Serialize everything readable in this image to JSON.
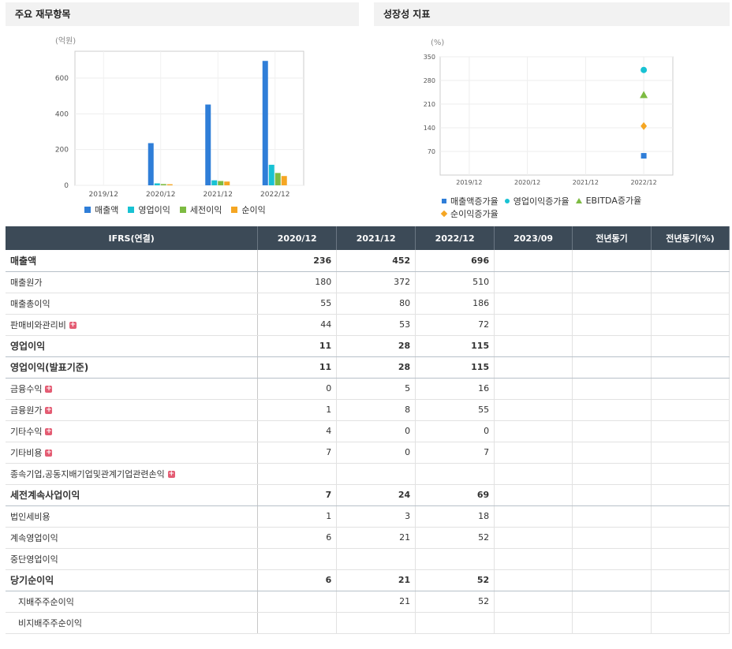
{
  "left_panel": {
    "title": "주요 재무항목"
  },
  "right_panel": {
    "title": "성장성 지표"
  },
  "colors": {
    "sales": "#2f7ed8",
    "op": "#18c2d3",
    "pretax": "#7dbb42",
    "net": "#f5a623"
  },
  "chart_data": [
    {
      "type": "bar",
      "title": "주요 재무항목",
      "unit_label": "(억원)",
      "categories": [
        "2019/12",
        "2020/12",
        "2021/12",
        "2022/12"
      ],
      "ylim": [
        0,
        750
      ],
      "yticks": [
        "0",
        "200",
        "400",
        "600"
      ],
      "ytick_values": [
        0,
        200,
        400,
        600
      ],
      "legend_position": "bottom",
      "series": [
        {
          "name": "매출액",
          "color": "#2f7ed8",
          "values": [
            null,
            236,
            452,
            696
          ]
        },
        {
          "name": "영업이익",
          "color": "#18c2d3",
          "values": [
            null,
            11,
            28,
            115
          ]
        },
        {
          "name": "세전이익",
          "color": "#7dbb42",
          "values": [
            null,
            7,
            24,
            69
          ]
        },
        {
          "name": "순이익",
          "color": "#f5a623",
          "values": [
            null,
            6,
            21,
            52
          ]
        }
      ]
    },
    {
      "type": "scatter",
      "title": "성장성 지표",
      "unit_label": "(%)",
      "categories": [
        "2019/12",
        "2020/12",
        "2021/12",
        "2022/12"
      ],
      "ylim": [
        0,
        350
      ],
      "yticks": [
        "70",
        "140",
        "210",
        "280",
        "350"
      ],
      "ytick_values": [
        70,
        140,
        210,
        280,
        350
      ],
      "legend_position": "bottom",
      "series": [
        {
          "name": "매출액증가율",
          "color": "#2f7ed8",
          "shape": "square",
          "values": [
            null,
            null,
            null,
            57
          ]
        },
        {
          "name": "영업이익증가율",
          "color": "#18c2d3",
          "shape": "circle",
          "values": [
            null,
            null,
            null,
            311
          ]
        },
        {
          "name": "EBITDA증가율",
          "color": "#7dbb42",
          "shape": "triangle",
          "values": [
            null,
            null,
            null,
            237
          ]
        },
        {
          "name": "순이익증가율",
          "color": "#f5a623",
          "shape": "diamond",
          "values": [
            null,
            null,
            null,
            145
          ]
        }
      ]
    }
  ],
  "table": {
    "headers": [
      "IFRS(연결)",
      "2020/12",
      "2021/12",
      "2022/12",
      "2023/09",
      "전년동기",
      "전년동기(%)"
    ],
    "rows": [
      {
        "label": "매출액",
        "bold": true,
        "plus": false,
        "sub": false,
        "values": [
          "236",
          "452",
          "696",
          "",
          "",
          ""
        ]
      },
      {
        "label": "매출원가",
        "bold": false,
        "plus": false,
        "sub": false,
        "values": [
          "180",
          "372",
          "510",
          "",
          "",
          ""
        ]
      },
      {
        "label": "매출총이익",
        "bold": false,
        "plus": false,
        "sub": false,
        "values": [
          "55",
          "80",
          "186",
          "",
          "",
          ""
        ]
      },
      {
        "label": "판매비와관리비",
        "bold": false,
        "plus": true,
        "sub": false,
        "values": [
          "44",
          "53",
          "72",
          "",
          "",
          ""
        ]
      },
      {
        "label": "영업이익",
        "bold": true,
        "plus": false,
        "sub": false,
        "values": [
          "11",
          "28",
          "115",
          "",
          "",
          ""
        ]
      },
      {
        "label": "영업이익(발표기준)",
        "bold": true,
        "plus": false,
        "sub": false,
        "values": [
          "11",
          "28",
          "115",
          "",
          "",
          ""
        ]
      },
      {
        "label": "금융수익",
        "bold": false,
        "plus": true,
        "sub": false,
        "values": [
          "0",
          "5",
          "16",
          "",
          "",
          ""
        ]
      },
      {
        "label": "금융원가",
        "bold": false,
        "plus": true,
        "sub": false,
        "values": [
          "1",
          "8",
          "55",
          "",
          "",
          ""
        ]
      },
      {
        "label": "기타수익",
        "bold": false,
        "plus": true,
        "sub": false,
        "values": [
          "4",
          "0",
          "0",
          "",
          "",
          ""
        ]
      },
      {
        "label": "기타비용",
        "bold": false,
        "plus": true,
        "sub": false,
        "values": [
          "7",
          "0",
          "7",
          "",
          "",
          ""
        ]
      },
      {
        "label": "종속기업,공동지배기업및관계기업관련손익",
        "bold": false,
        "plus": true,
        "sub": false,
        "values": [
          "",
          "",
          "",
          "",
          "",
          ""
        ]
      },
      {
        "label": "세전계속사업이익",
        "bold": true,
        "plus": false,
        "sub": false,
        "values": [
          "7",
          "24",
          "69",
          "",
          "",
          ""
        ]
      },
      {
        "label": "법인세비용",
        "bold": false,
        "plus": false,
        "sub": false,
        "values": [
          "1",
          "3",
          "18",
          "",
          "",
          ""
        ]
      },
      {
        "label": "계속영업이익",
        "bold": false,
        "plus": false,
        "sub": false,
        "values": [
          "6",
          "21",
          "52",
          "",
          "",
          ""
        ]
      },
      {
        "label": "중단영업이익",
        "bold": false,
        "plus": false,
        "sub": false,
        "values": [
          "",
          "",
          "",
          "",
          "",
          ""
        ]
      },
      {
        "label": "당기순이익",
        "bold": true,
        "plus": false,
        "sub": false,
        "values": [
          "6",
          "21",
          "52",
          "",
          "",
          ""
        ]
      },
      {
        "label": "지배주주순이익",
        "bold": false,
        "plus": false,
        "sub": true,
        "values": [
          "",
          "21",
          "52",
          "",
          "",
          ""
        ]
      },
      {
        "label": "비지배주주순이익",
        "bold": false,
        "plus": false,
        "sub": true,
        "values": [
          "",
          "",
          "",
          "",
          "",
          ""
        ]
      }
    ]
  }
}
